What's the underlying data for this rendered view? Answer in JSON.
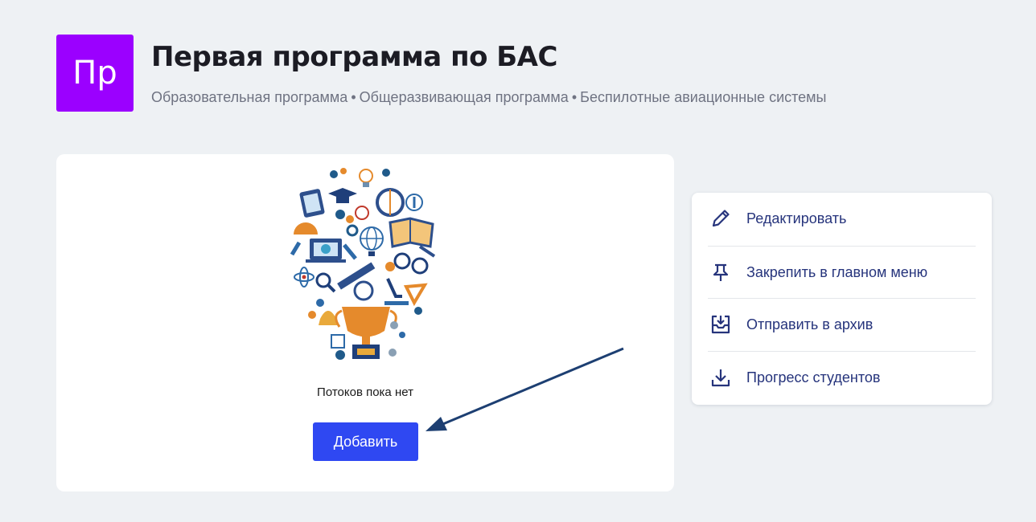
{
  "header": {
    "avatar_text": "Пр",
    "avatar_color": "#9b00ff",
    "title": "Первая программа по БАС",
    "tags": [
      "Образовательная программа",
      "Общеразвивающая программа",
      "Беспилотные авиационные системы"
    ]
  },
  "main": {
    "empty_text": "Потоков пока нет",
    "add_label": "Добавить",
    "accent": "#2f48f2"
  },
  "actions": [
    {
      "icon": "pencil-icon",
      "label": "Редактировать"
    },
    {
      "icon": "pin-icon",
      "label": "Закрепить в главном меню"
    },
    {
      "icon": "archive-icon",
      "label": "Отправить в архив"
    },
    {
      "icon": "download-icon",
      "label": "Прогресс студентов"
    }
  ]
}
